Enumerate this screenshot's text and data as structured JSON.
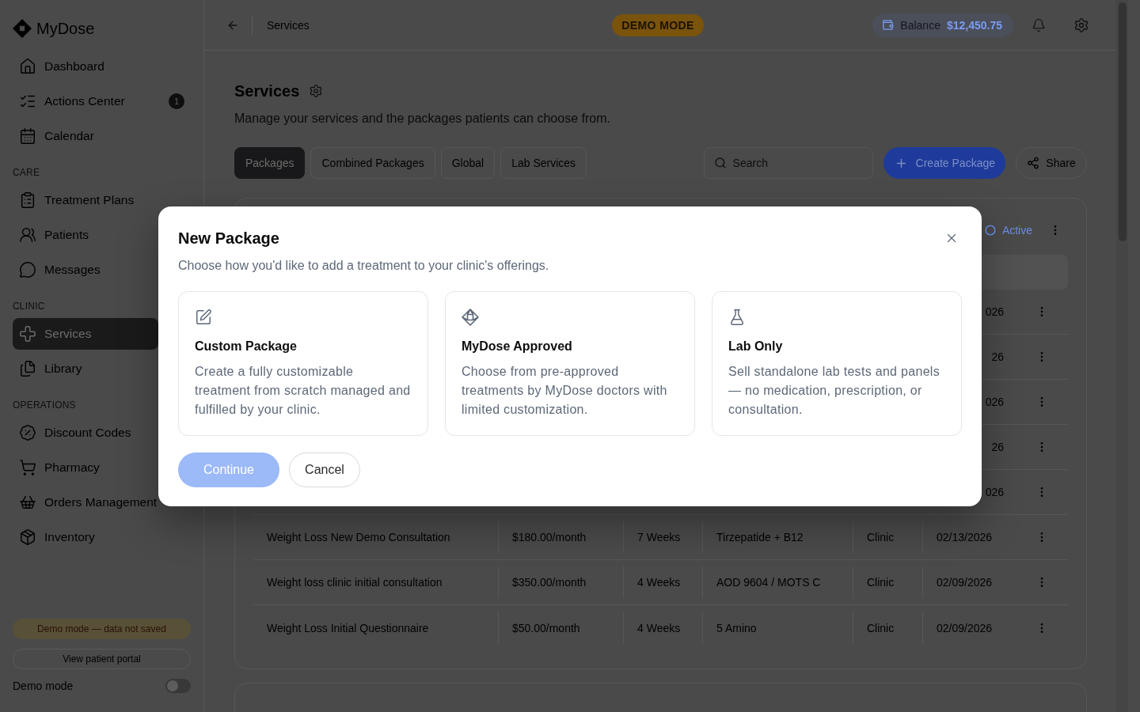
{
  "sidebar": {
    "brand": "MyDose",
    "sections": [
      {
        "items": [
          {
            "label": "Dashboard",
            "selected": false
          },
          {
            "label": "Actions Center",
            "selected": false,
            "badge": "1"
          },
          {
            "label": "Calendar",
            "selected": false
          }
        ]
      },
      {
        "heading": "CARE",
        "items": [
          {
            "label": "Treatment Plans",
            "selected": false
          },
          {
            "label": "Patients",
            "selected": false
          },
          {
            "label": "Messages",
            "selected": false
          }
        ]
      },
      {
        "heading": "CLINIC",
        "items": [
          {
            "label": "Services",
            "selected": true
          },
          {
            "label": "Library",
            "selected": false
          }
        ]
      },
      {
        "heading": "OPERATIONS",
        "items": [
          {
            "label": "Discount Codes",
            "selected": false
          },
          {
            "label": "Pharmacy",
            "selected": false
          },
          {
            "label": "Orders Management",
            "selected": false
          },
          {
            "label": "Inventory",
            "selected": false
          }
        ]
      }
    ],
    "demo_notice": "Demo mode — data not saved",
    "portal_button": "View patient portal",
    "demo_toggle": {
      "label": "Demo mode",
      "on": false
    }
  },
  "topbar": {
    "title": "Services",
    "mode_badge": "DEMO MODE",
    "balance": {
      "label": "Balance",
      "value": "$12,450.75"
    }
  },
  "page": {
    "title": "Services",
    "subtitle": "Manage your services and the packages patients can choose from.",
    "tabs": [
      {
        "label": "Packages",
        "selected": true
      },
      {
        "label": "Combined Packages",
        "selected": false
      },
      {
        "label": "Global",
        "selected": false
      },
      {
        "label": "Lab Services",
        "selected": false
      }
    ],
    "search": {
      "placeholder": "Search"
    },
    "create_button": "Create Package",
    "share_button": "Share"
  },
  "packages_table": {
    "status": "Active",
    "rows": [
      {
        "kind": "covered",
        "cells": [
          "026"
        ]
      },
      {
        "kind": "covered",
        "cells": [
          "26"
        ]
      },
      {
        "kind": "covered",
        "cells": [
          "026"
        ]
      },
      {
        "kind": "covered",
        "cells": [
          "26"
        ]
      },
      {
        "kind": "covered",
        "cells": [
          "026"
        ]
      },
      {
        "kind": "full",
        "cells": [
          "Weight Loss New Demo Consultation",
          "$180.00/month",
          "7 Weeks",
          "Tirzepatide + B12",
          "Clinic",
          "02/13/2026"
        ]
      },
      {
        "kind": "full",
        "cells": [
          "Weight loss clinic initial consultation",
          "$350.00/month",
          "4 Weeks",
          "AOD 9604 / MOTS C",
          "Clinic",
          "02/09/2026"
        ]
      },
      {
        "kind": "full",
        "cells": [
          "Weight Loss Initial Questionnaire",
          "$50.00/month",
          "4 Weeks",
          "5 Amino",
          "Clinic",
          "02/09/2026"
        ]
      }
    ]
  },
  "dialog": {
    "title": "New Package",
    "subtitle": "Choose how you'd like to add a treatment to your clinic's offerings.",
    "options": [
      {
        "title": "Custom Package",
        "description": "Create a fully customizable treatment from scratch managed and fulfilled by your clinic.",
        "selected": false
      },
      {
        "title": "MyDose Approved",
        "description": "Choose from pre-approved treatments by MyDose doctors with limited customization.",
        "selected": false
      },
      {
        "title": "Lab Only",
        "description": "Sell standalone lab tests and panels — no medication, prescription, or consultation.",
        "selected": false
      }
    ],
    "continue_button": {
      "label": "Continue",
      "disabled": true
    },
    "cancel_button": "Cancel"
  }
}
